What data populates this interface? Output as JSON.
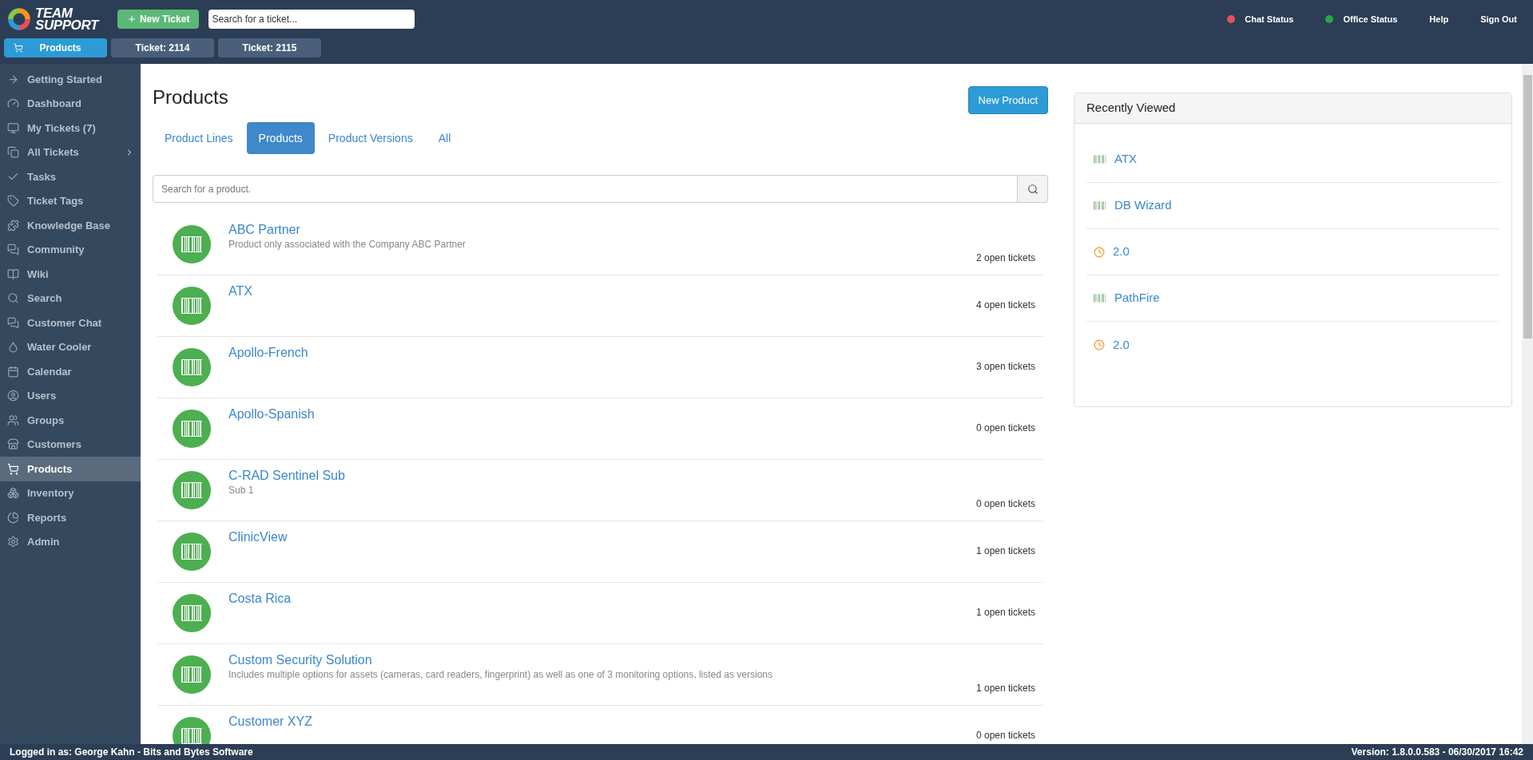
{
  "logo": {
    "line_1": "TEAM",
    "line_2": "SUPPORT"
  },
  "header": {
    "new_ticket": "New Ticket",
    "search": {
      "placeholder": "Search for a ticket..."
    },
    "status": [
      {
        "label": "Chat Status",
        "color": "#e8505b"
      },
      {
        "label": "Office Status",
        "color": "#27a745"
      }
    ],
    "links": [
      "Help",
      "Sign Out"
    ]
  },
  "open_tabs": [
    {
      "label": "Products",
      "selected": true,
      "kind": "cart"
    },
    {
      "label": "Ticket: 2114",
      "selected": false,
      "kind": "plain"
    },
    {
      "label": "Ticket: 2115",
      "selected": false,
      "kind": "plain"
    }
  ],
  "sidebar": {
    "items": [
      {
        "label": "Getting Started",
        "selected": false
      },
      {
        "label": "Dashboard",
        "selected": false
      },
      {
        "label": "My Tickets (7)",
        "selected": false
      },
      {
        "label": "All Tickets",
        "selected": false,
        "expandable": true
      },
      {
        "label": "Tasks",
        "selected": false
      },
      {
        "label": "Ticket Tags",
        "selected": false
      },
      {
        "label": "Knowledge Base",
        "selected": false
      },
      {
        "label": "Community",
        "selected": false
      },
      {
        "label": "Wiki",
        "selected": false
      },
      {
        "label": "Search",
        "selected": false
      },
      {
        "label": "Customer Chat",
        "selected": false
      },
      {
        "label": "Water Cooler",
        "selected": false
      },
      {
        "label": "Calendar",
        "selected": false
      },
      {
        "label": "Users",
        "selected": false
      },
      {
        "label": "Groups",
        "selected": false
      },
      {
        "label": "Customers",
        "selected": false
      },
      {
        "label": "Products",
        "selected": true
      },
      {
        "label": "Inventory",
        "selected": false
      },
      {
        "label": "Reports",
        "selected": false
      },
      {
        "label": "Admin",
        "selected": false
      }
    ]
  },
  "page": {
    "title": "Products",
    "new_button": "New Product",
    "tabs": [
      {
        "label": "Product Lines",
        "selected": false
      },
      {
        "label": "Products",
        "selected": true
      },
      {
        "label": "Product Versions",
        "selected": false
      },
      {
        "label": "All",
        "selected": false
      }
    ],
    "search": {
      "placeholder": "Search for a product."
    },
    "products": [
      {
        "name": "ABC Partner",
        "description": "Product only associated with the Company ABC Partner",
        "count": "2 open tickets"
      },
      {
        "name": "ATX",
        "count": "4 open tickets"
      },
      {
        "name": "Apollo-French",
        "count": "3 open tickets"
      },
      {
        "name": "Apollo-Spanish",
        "count": "0 open tickets"
      },
      {
        "name": "C-RAD Sentinel Sub",
        "description": "Sub 1",
        "count": "0 open tickets"
      },
      {
        "name": "ClinicView",
        "count": "1 open tickets"
      },
      {
        "name": "Costa Rica",
        "count": "1 open tickets"
      },
      {
        "name": "Custom Security Solution",
        "description": "Includes multiple options for assets (cameras, card readers, fingerprint) as well as one of 3 monitoring options, listed as versions",
        "count": "1 open tickets"
      },
      {
        "name": "Customer XYZ",
        "count": "0 open tickets"
      }
    ]
  },
  "recently_viewed": {
    "title": "Recently Viewed",
    "items": [
      {
        "label": "ATX",
        "kind": "product"
      },
      {
        "label": "DB Wizard",
        "kind": "product"
      },
      {
        "label": "2.0",
        "kind": "version"
      },
      {
        "label": "PathFire",
        "kind": "product"
      },
      {
        "label": "2.0",
        "kind": "version"
      }
    ]
  },
  "status_bar": {
    "user": "Logged in as: George Kahn - Bits and Bytes Software",
    "version": "Version: 1.8.0.0.583 - 06/30/2017 16:42"
  }
}
